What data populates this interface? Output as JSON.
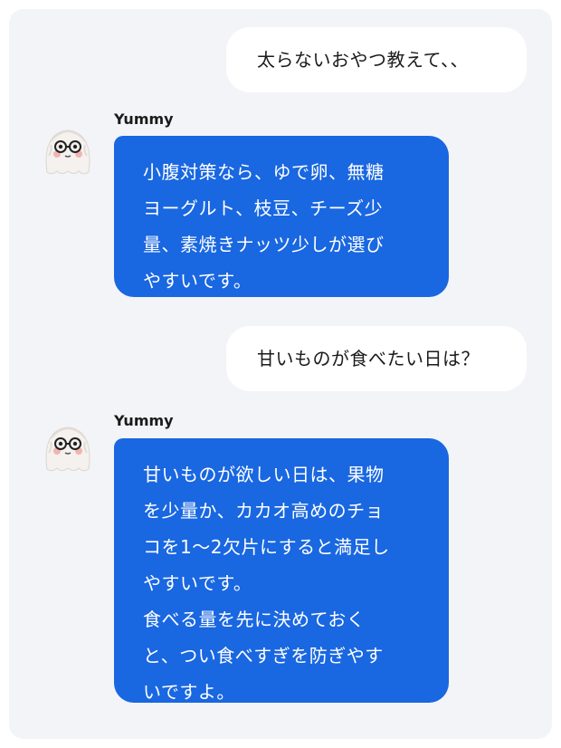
{
  "conversation": {
    "messages": [
      {
        "role": "user",
        "text": "太らないおやつ教えて、、"
      },
      {
        "role": "assistant",
        "sender": "Yummy",
        "avatar_icon": "fluffy-ghost-with-glasses-icon",
        "lines": [
          "小腹対策なら、ゆで卵、無糖",
          "ヨーグルト、枝豆、チーズ少",
          "量、素焼きナッツ少しが選び",
          "やすいです。"
        ]
      },
      {
        "role": "user",
        "text": "甘いものが食べたい日は？"
      },
      {
        "role": "assistant",
        "sender": "Yummy",
        "avatar_icon": "fluffy-ghost-with-glasses-icon",
        "lines": [
          "甘いものが欲しい日は、果物",
          "を少量か、カカオ高めのチョ",
          "コを1〜2欠片にすると満足し",
          "やすいです。",
          "食べる量を先に決めておく",
          "と、つい食べすぎを防ぎやす",
          "いですよ。"
        ]
      }
    ]
  },
  "colors": {
    "bot_bubble": "#1967e1",
    "user_bubble": "#ffffff",
    "panel_background": "#f3f4f7"
  }
}
